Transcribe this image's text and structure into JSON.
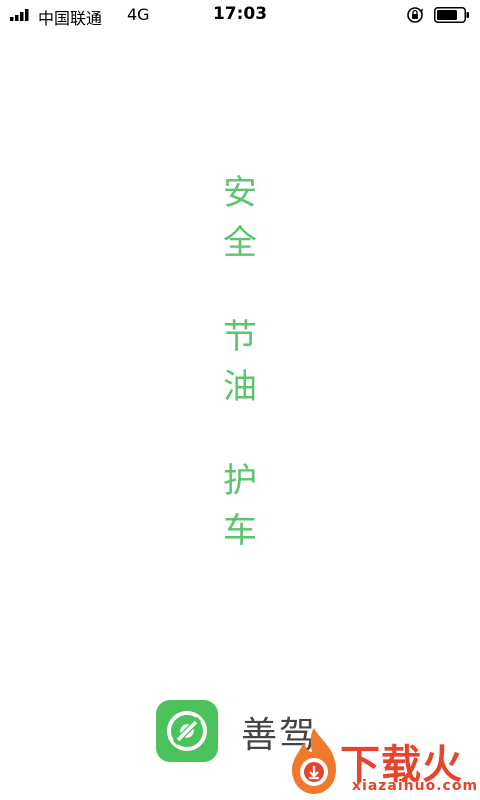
{
  "status_bar": {
    "carrier": "中国联通",
    "network": "4G",
    "time": "17:03"
  },
  "slogan": [
    {
      "line1": "安",
      "line2": "全"
    },
    {
      "line1": "节",
      "line2": "油"
    },
    {
      "line1": "护",
      "line2": "车"
    }
  ],
  "brand": {
    "name": "善驾",
    "icon_color": "#4cc25c"
  },
  "watermark": {
    "text": "下载火",
    "url": "xiazaihuo.com",
    "color": "#e8442c"
  },
  "colors": {
    "accent": "#5cc46e",
    "background": "#ffffff"
  }
}
